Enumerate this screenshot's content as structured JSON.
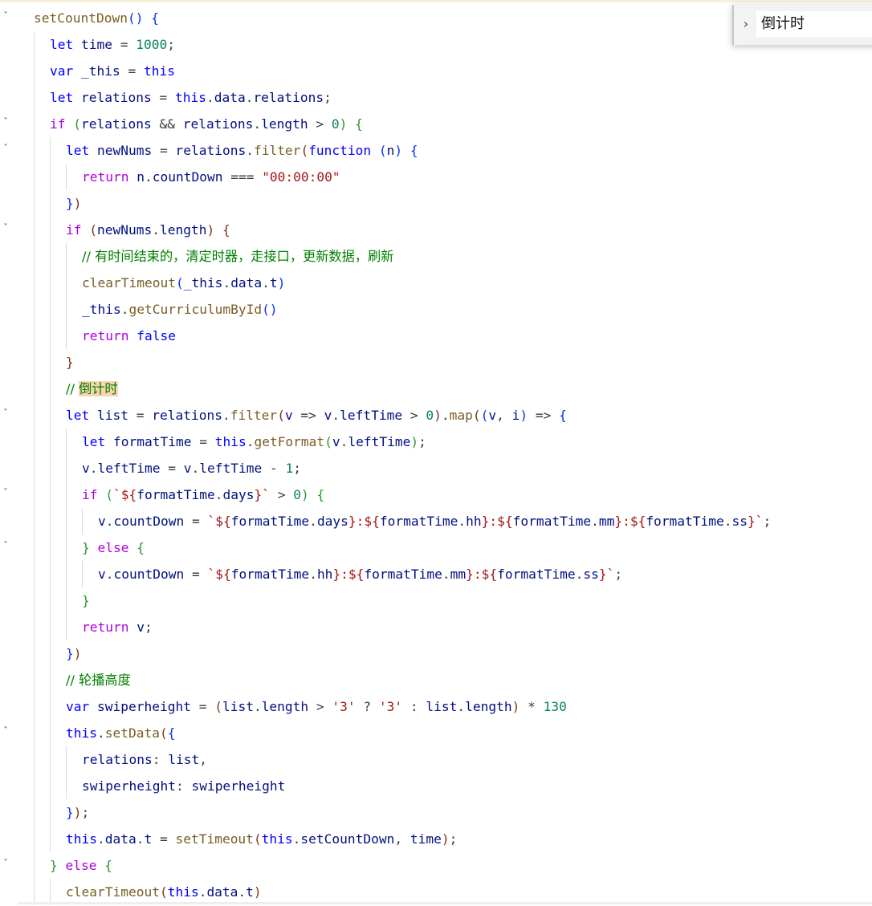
{
  "find": {
    "query": "倒计时",
    "expand_icon": "chevron-right-icon"
  },
  "colors": {
    "keyword": "#0000ff",
    "control": "#af00db",
    "string": "#a31515",
    "number": "#098658",
    "comment": "#008000",
    "function": "#795e26",
    "variable": "#001080",
    "highlight": "#f8d4b0"
  },
  "code_lines": [
    [
      [
        "tk-fn",
        "setCountDown"
      ],
      [
        "tk-br1",
        "()"
      ],
      [
        "tk-op",
        " "
      ],
      [
        "tk-br1",
        "{"
      ]
    ],
    [
      [
        "tk-kw",
        "let"
      ],
      [
        "tk-op",
        " "
      ],
      [
        "tk-var",
        "time"
      ],
      [
        "tk-op",
        " = "
      ],
      [
        "tk-num",
        "1000"
      ],
      [
        "tk-op",
        ";"
      ]
    ],
    [
      [
        "tk-kw",
        "var"
      ],
      [
        "tk-op",
        " "
      ],
      [
        "tk-var",
        "_this"
      ],
      [
        "tk-op",
        " = "
      ],
      [
        "tk-kw",
        "this"
      ]
    ],
    [
      [
        "tk-kw",
        "let"
      ],
      [
        "tk-op",
        " "
      ],
      [
        "tk-var",
        "relations"
      ],
      [
        "tk-op",
        " = "
      ],
      [
        "tk-kw",
        "this"
      ],
      [
        "tk-op",
        "."
      ],
      [
        "tk-var",
        "data"
      ],
      [
        "tk-op",
        "."
      ],
      [
        "tk-var",
        "relations"
      ],
      [
        "tk-op",
        ";"
      ]
    ],
    [
      [
        "tk-ctl",
        "if"
      ],
      [
        "tk-op",
        " "
      ],
      [
        "tk-br2",
        "("
      ],
      [
        "tk-var",
        "relations"
      ],
      [
        "tk-op",
        " && "
      ],
      [
        "tk-var",
        "relations"
      ],
      [
        "tk-op",
        "."
      ],
      [
        "tk-var",
        "length"
      ],
      [
        "tk-op",
        " > "
      ],
      [
        "tk-num",
        "0"
      ],
      [
        "tk-br2",
        ")"
      ],
      [
        "tk-op",
        " "
      ],
      [
        "tk-br2",
        "{"
      ]
    ],
    [
      [
        "tk-kw",
        "let"
      ],
      [
        "tk-op",
        " "
      ],
      [
        "tk-var",
        "newNums"
      ],
      [
        "tk-op",
        " = "
      ],
      [
        "tk-var",
        "relations"
      ],
      [
        "tk-op",
        "."
      ],
      [
        "tk-fn",
        "filter"
      ],
      [
        "tk-br3",
        "("
      ],
      [
        "tk-kw",
        "function"
      ],
      [
        "tk-op",
        " "
      ],
      [
        "tk-br1",
        "("
      ],
      [
        "tk-var",
        "n"
      ],
      [
        "tk-br1",
        ")"
      ],
      [
        "tk-op",
        " "
      ],
      [
        "tk-br1",
        "{"
      ]
    ],
    [
      [
        "tk-ctl",
        "return"
      ],
      [
        "tk-op",
        " "
      ],
      [
        "tk-var",
        "n"
      ],
      [
        "tk-op",
        "."
      ],
      [
        "tk-var",
        "countDown"
      ],
      [
        "tk-op",
        " === "
      ],
      [
        "tk-str",
        "\"00:00:00\""
      ]
    ],
    [
      [
        "tk-br1",
        "}"
      ],
      [
        "tk-br3",
        ")"
      ]
    ],
    [
      [
        "tk-ctl",
        "if"
      ],
      [
        "tk-op",
        " "
      ],
      [
        "tk-br3",
        "("
      ],
      [
        "tk-var",
        "newNums"
      ],
      [
        "tk-op",
        "."
      ],
      [
        "tk-var",
        "length"
      ],
      [
        "tk-br3",
        ")"
      ],
      [
        "tk-op",
        " "
      ],
      [
        "tk-br3",
        "{"
      ]
    ],
    [
      [
        "tk-cmt",
        "// 有时间结束的，清定时器，走接口，更新数据，刷新"
      ]
    ],
    [
      [
        "tk-fn",
        "clearTimeout"
      ],
      [
        "tk-br1",
        "("
      ],
      [
        "tk-var",
        "_this"
      ],
      [
        "tk-op",
        "."
      ],
      [
        "tk-var",
        "data"
      ],
      [
        "tk-op",
        "."
      ],
      [
        "tk-var",
        "t"
      ],
      [
        "tk-br1",
        ")"
      ]
    ],
    [
      [
        "tk-var",
        "_this"
      ],
      [
        "tk-op",
        "."
      ],
      [
        "tk-fn",
        "getCurriculumById"
      ],
      [
        "tk-br1",
        "()"
      ]
    ],
    [
      [
        "tk-ctl",
        "return"
      ],
      [
        "tk-op",
        " "
      ],
      [
        "tk-kw",
        "false"
      ]
    ],
    [
      [
        "tk-br3",
        "}"
      ]
    ],
    [
      [
        "tk-cmt",
        "// "
      ],
      [
        "tk-cmt hl",
        "倒计时"
      ]
    ],
    [
      [
        "tk-kw",
        "let"
      ],
      [
        "tk-op",
        " "
      ],
      [
        "tk-var",
        "list"
      ],
      [
        "tk-op",
        " = "
      ],
      [
        "tk-var",
        "relations"
      ],
      [
        "tk-op",
        "."
      ],
      [
        "tk-fn",
        "filter"
      ],
      [
        "tk-br3",
        "("
      ],
      [
        "tk-var",
        "v"
      ],
      [
        "tk-op",
        " => "
      ],
      [
        "tk-var",
        "v"
      ],
      [
        "tk-op",
        "."
      ],
      [
        "tk-var",
        "leftTime"
      ],
      [
        "tk-op",
        " > "
      ],
      [
        "tk-num",
        "0"
      ],
      [
        "tk-br3",
        ")"
      ],
      [
        "tk-op",
        "."
      ],
      [
        "tk-fn",
        "map"
      ],
      [
        "tk-br3",
        "("
      ],
      [
        "tk-br1",
        "("
      ],
      [
        "tk-var",
        "v"
      ],
      [
        "tk-op",
        ", "
      ],
      [
        "tk-var",
        "i"
      ],
      [
        "tk-br1",
        ")"
      ],
      [
        "tk-op",
        " => "
      ],
      [
        "tk-br1",
        "{"
      ]
    ],
    [
      [
        "tk-kw",
        "let"
      ],
      [
        "tk-op",
        " "
      ],
      [
        "tk-var",
        "formatTime"
      ],
      [
        "tk-op",
        " = "
      ],
      [
        "tk-kw",
        "this"
      ],
      [
        "tk-op",
        "."
      ],
      [
        "tk-fn",
        "getFormat"
      ],
      [
        "tk-br2",
        "("
      ],
      [
        "tk-var",
        "v"
      ],
      [
        "tk-op",
        "."
      ],
      [
        "tk-var",
        "leftTime"
      ],
      [
        "tk-br2",
        ")"
      ],
      [
        "tk-op",
        ";"
      ]
    ],
    [
      [
        "tk-var",
        "v"
      ],
      [
        "tk-op",
        "."
      ],
      [
        "tk-var",
        "leftTime"
      ],
      [
        "tk-op",
        " = "
      ],
      [
        "tk-var",
        "v"
      ],
      [
        "tk-op",
        "."
      ],
      [
        "tk-var",
        "leftTime"
      ],
      [
        "tk-op",
        " - "
      ],
      [
        "tk-num",
        "1"
      ],
      [
        "tk-op",
        ";"
      ]
    ],
    [
      [
        "tk-ctl",
        "if"
      ],
      [
        "tk-op",
        " "
      ],
      [
        "tk-br2",
        "("
      ],
      [
        "tk-tpl",
        "`${"
      ],
      [
        "tk-var",
        "formatTime"
      ],
      [
        "tk-op",
        "."
      ],
      [
        "tk-var",
        "days"
      ],
      [
        "tk-tpl",
        "}`"
      ],
      [
        "tk-op",
        " > "
      ],
      [
        "tk-num",
        "0"
      ],
      [
        "tk-br2",
        ")"
      ],
      [
        "tk-op",
        " "
      ],
      [
        "tk-br2",
        "{"
      ]
    ],
    [
      [
        "tk-var",
        "v"
      ],
      [
        "tk-op",
        "."
      ],
      [
        "tk-var",
        "countDown"
      ],
      [
        "tk-op",
        " = "
      ],
      [
        "tk-tpl",
        "`${"
      ],
      [
        "tk-var",
        "formatTime"
      ],
      [
        "tk-op",
        "."
      ],
      [
        "tk-var",
        "days"
      ],
      [
        "tk-tpl",
        "}:${"
      ],
      [
        "tk-var",
        "formatTime"
      ],
      [
        "tk-op",
        "."
      ],
      [
        "tk-var",
        "hh"
      ],
      [
        "tk-tpl",
        "}:${"
      ],
      [
        "tk-var",
        "formatTime"
      ],
      [
        "tk-op",
        "."
      ],
      [
        "tk-var",
        "mm"
      ],
      [
        "tk-tpl",
        "}:${"
      ],
      [
        "tk-var",
        "formatTime"
      ],
      [
        "tk-op",
        "."
      ],
      [
        "tk-var",
        "ss"
      ],
      [
        "tk-tpl",
        "}`"
      ],
      [
        "tk-op",
        ";"
      ]
    ],
    [
      [
        "tk-br2",
        "}"
      ],
      [
        "tk-op",
        " "
      ],
      [
        "tk-ctl",
        "else"
      ],
      [
        "tk-op",
        " "
      ],
      [
        "tk-br2",
        "{"
      ]
    ],
    [
      [
        "tk-var",
        "v"
      ],
      [
        "tk-op",
        "."
      ],
      [
        "tk-var",
        "countDown"
      ],
      [
        "tk-op",
        " = "
      ],
      [
        "tk-tpl",
        "`${"
      ],
      [
        "tk-var",
        "formatTime"
      ],
      [
        "tk-op",
        "."
      ],
      [
        "tk-var",
        "hh"
      ],
      [
        "tk-tpl",
        "}:${"
      ],
      [
        "tk-var",
        "formatTime"
      ],
      [
        "tk-op",
        "."
      ],
      [
        "tk-var",
        "mm"
      ],
      [
        "tk-tpl",
        "}:${"
      ],
      [
        "tk-var",
        "formatTime"
      ],
      [
        "tk-op",
        "."
      ],
      [
        "tk-var",
        "ss"
      ],
      [
        "tk-tpl",
        "}`"
      ],
      [
        "tk-op",
        ";"
      ]
    ],
    [
      [
        "tk-br2",
        "}"
      ]
    ],
    [
      [
        "tk-ctl",
        "return"
      ],
      [
        "tk-op",
        " "
      ],
      [
        "tk-var",
        "v"
      ],
      [
        "tk-op",
        ";"
      ]
    ],
    [
      [
        "tk-br1",
        "}"
      ],
      [
        "tk-br3",
        ")"
      ]
    ],
    [
      [
        "tk-cmt",
        "// 轮播高度"
      ]
    ],
    [
      [
        "tk-kw",
        "var"
      ],
      [
        "tk-op",
        " "
      ],
      [
        "tk-var",
        "swiperheight"
      ],
      [
        "tk-op",
        " = "
      ],
      [
        "tk-br3",
        "("
      ],
      [
        "tk-var",
        "list"
      ],
      [
        "tk-op",
        "."
      ],
      [
        "tk-var",
        "length"
      ],
      [
        "tk-op",
        " > "
      ],
      [
        "tk-str",
        "'3'"
      ],
      [
        "tk-op",
        " ? "
      ],
      [
        "tk-str",
        "'3'"
      ],
      [
        "tk-op",
        " : "
      ],
      [
        "tk-var",
        "list"
      ],
      [
        "tk-op",
        "."
      ],
      [
        "tk-var",
        "length"
      ],
      [
        "tk-br3",
        ")"
      ],
      [
        "tk-op",
        " * "
      ],
      [
        "tk-num",
        "130"
      ]
    ],
    [
      [
        "tk-kw",
        "this"
      ],
      [
        "tk-op",
        "."
      ],
      [
        "tk-fn",
        "setData"
      ],
      [
        "tk-br3",
        "("
      ],
      [
        "tk-br1",
        "{"
      ]
    ],
    [
      [
        "tk-var",
        "relations"
      ],
      [
        "tk-op",
        ": "
      ],
      [
        "tk-var",
        "list"
      ],
      [
        "tk-op",
        ","
      ]
    ],
    [
      [
        "tk-var",
        "swiperheight"
      ],
      [
        "tk-op",
        ": "
      ],
      [
        "tk-var",
        "swiperheight"
      ]
    ],
    [
      [
        "tk-br1",
        "}"
      ],
      [
        "tk-br3",
        ")"
      ],
      [
        "tk-op",
        ";"
      ]
    ],
    [
      [
        "tk-kw",
        "this"
      ],
      [
        "tk-op",
        "."
      ],
      [
        "tk-var",
        "data"
      ],
      [
        "tk-op",
        "."
      ],
      [
        "tk-var",
        "t"
      ],
      [
        "tk-op",
        " = "
      ],
      [
        "tk-fn",
        "setTimeout"
      ],
      [
        "tk-br3",
        "("
      ],
      [
        "tk-kw",
        "this"
      ],
      [
        "tk-op",
        "."
      ],
      [
        "tk-var",
        "setCountDown"
      ],
      [
        "tk-op",
        ", "
      ],
      [
        "tk-var",
        "time"
      ],
      [
        "tk-br3",
        ")"
      ],
      [
        "tk-op",
        ";"
      ]
    ],
    [
      [
        "tk-br2",
        "}"
      ],
      [
        "tk-op",
        " "
      ],
      [
        "tk-ctl",
        "else"
      ],
      [
        "tk-op",
        " "
      ],
      [
        "tk-br2",
        "{"
      ]
    ],
    [
      [
        "tk-fn",
        "clearTimeout"
      ],
      [
        "tk-br3",
        "("
      ],
      [
        "tk-kw",
        "this"
      ],
      [
        "tk-op",
        "."
      ],
      [
        "tk-var",
        "data"
      ],
      [
        "tk-op",
        "."
      ],
      [
        "tk-var",
        "t"
      ],
      [
        "tk-br3",
        ")"
      ]
    ]
  ]
}
